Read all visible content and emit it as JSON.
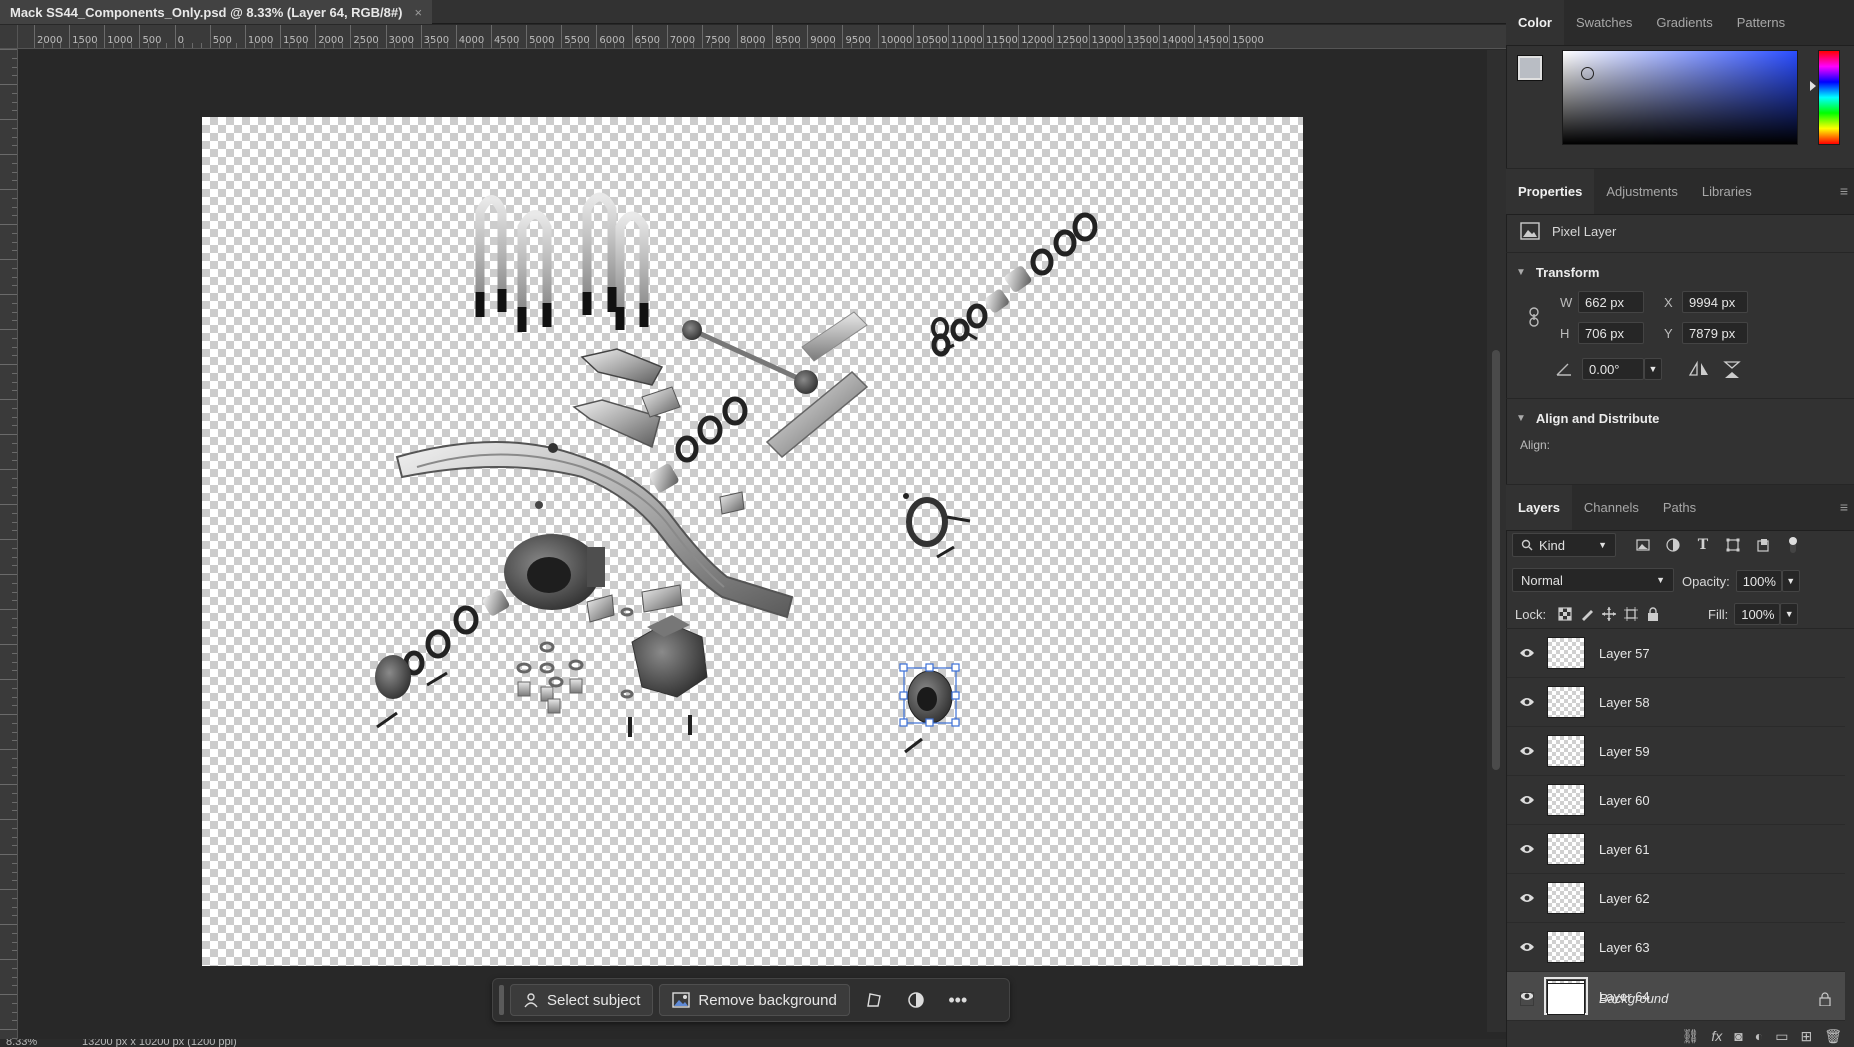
{
  "document": {
    "tab_title": "Mack SS44_Components_Only.psd @ 8.33% (Layer 64, RGB/8#)",
    "close_glyph": "×"
  },
  "ruler": {
    "top_labels": [
      "2000",
      "1500",
      "1000",
      "500",
      "0",
      "500",
      "1000",
      "1500",
      "2000",
      "2500",
      "3000",
      "3500",
      "4000",
      "4500",
      "5000",
      "5500",
      "6000",
      "6500",
      "7000",
      "7500",
      "8000",
      "8500",
      "9000",
      "9500",
      "10000",
      "10500",
      "11000",
      "11500",
      "12000",
      "12500",
      "13000",
      "13500",
      "14000",
      "14500",
      "15000"
    ]
  },
  "taskbar": {
    "select_subject": "Select subject",
    "remove_background": "Remove background",
    "more_glyph": "•••"
  },
  "status": {
    "zoom": "8.33%",
    "doc_size": "13200 px x 10200 px (1200 ppi)"
  },
  "color_panel": {
    "tabs": [
      "Color",
      "Swatches",
      "Gradients",
      "Patterns"
    ],
    "active_tab": "Color",
    "foreground_color": "#b9bdc4",
    "background_color": "#ffffff"
  },
  "properties_panel": {
    "tabs": [
      "Properties",
      "Adjustments",
      "Libraries"
    ],
    "layer_kind": "Pixel Layer",
    "transform_title": "Transform",
    "w_label": "W",
    "w_value": "662 px",
    "h_label": "H",
    "h_value": "706 px",
    "x_label": "X",
    "x_value": "9994 px",
    "y_label": "Y",
    "y_value": "7879 px",
    "angle_value": "0.00°",
    "align_title": "Align and Distribute",
    "align_label": "Align:"
  },
  "layers_panel": {
    "tabs": [
      "Layers",
      "Channels",
      "Paths"
    ],
    "filter_kind": "Kind",
    "blend_mode": "Normal",
    "opacity_label": "Opacity:",
    "opacity_value": "100%",
    "lock_label": "Lock:",
    "fill_label": "Fill:",
    "fill_value": "100%",
    "layers": [
      {
        "name": "Layer 57",
        "visible": true,
        "selected": false
      },
      {
        "name": "Layer 58",
        "visible": true,
        "selected": false
      },
      {
        "name": "Layer 59",
        "visible": true,
        "selected": false
      },
      {
        "name": "Layer 60",
        "visible": true,
        "selected": false
      },
      {
        "name": "Layer 61",
        "visible": true,
        "selected": false
      },
      {
        "name": "Layer 62",
        "visible": true,
        "selected": false
      },
      {
        "name": "Layer 63",
        "visible": true,
        "selected": false
      },
      {
        "name": "Layer 64",
        "visible": true,
        "selected": true
      }
    ],
    "background_layer": "Background"
  }
}
